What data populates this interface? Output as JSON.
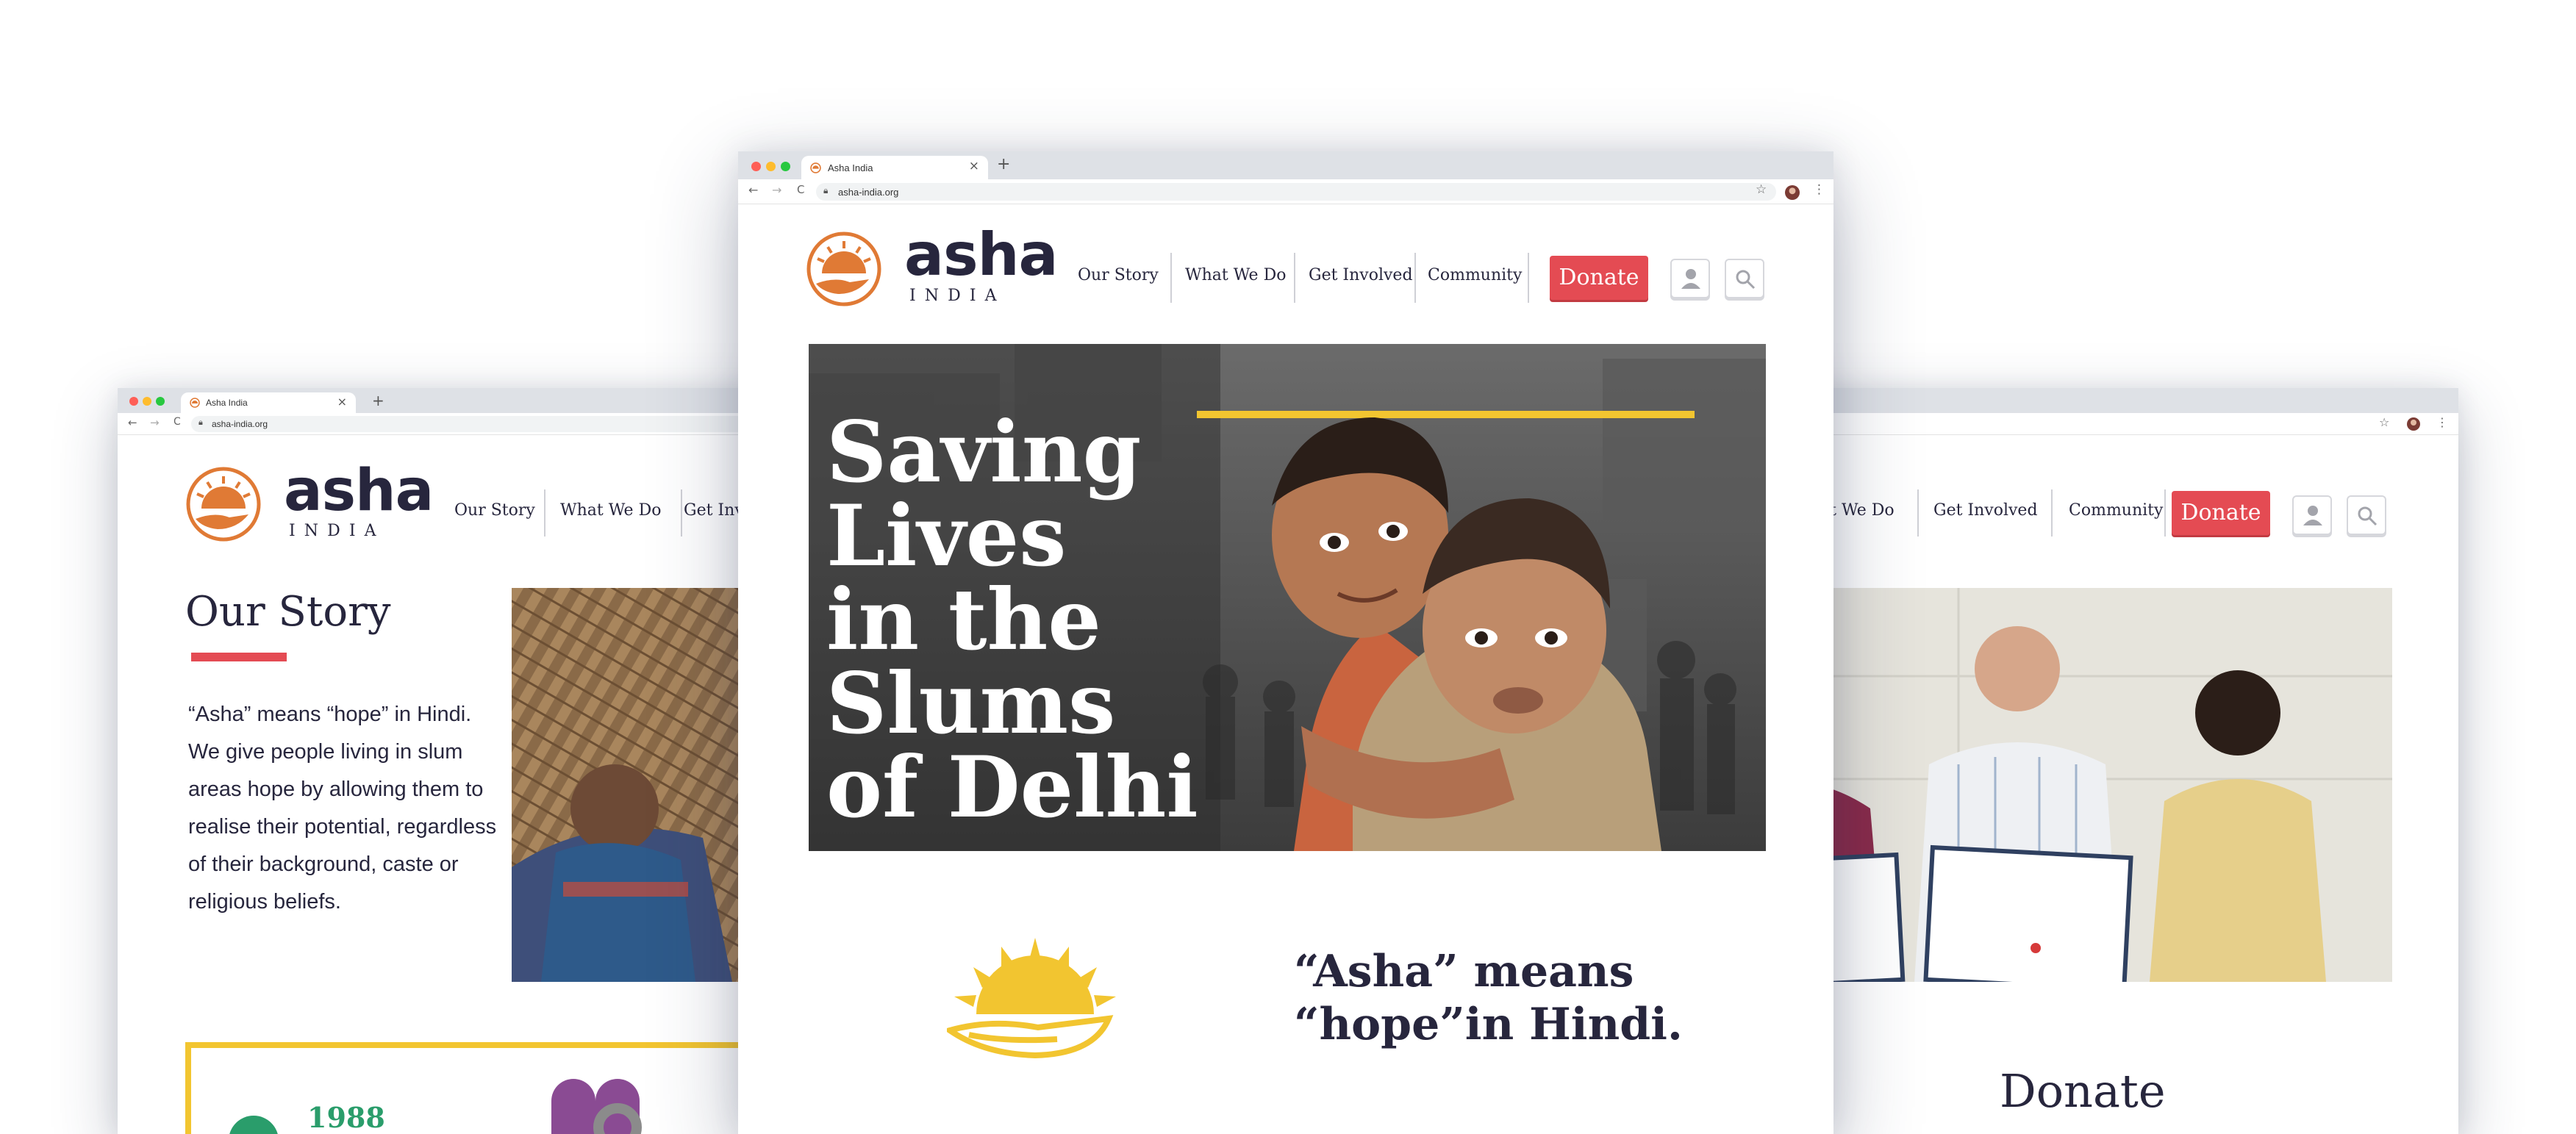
{
  "browser": {
    "tab_title": "Asha India",
    "tab_close": "×",
    "new_tab": "+",
    "url": "asha-india.org",
    "nav_back": "←",
    "nav_forward": "→",
    "nav_reload": "C",
    "bookmark": "☆",
    "menu": "⋮"
  },
  "brand": {
    "name": "asha",
    "tagline": "INDIA"
  },
  "nav": {
    "items": [
      "Our Story",
      "What We Do",
      "Get Involved",
      "Community"
    ],
    "left_partial_get_involved": "Get Invol",
    "right_partial_what_we_do": "at We Do",
    "donate": "Donate"
  },
  "hero": {
    "lines": [
      "Saving",
      "Lives",
      "in the",
      "Slums",
      "of Delhi"
    ]
  },
  "meaning": {
    "line1": "“Asha” means",
    "line2": "“hope”in Hindi."
  },
  "our_story": {
    "heading": "Our Story",
    "paragraph_lines": [
      "“Asha” means “hope” in Hindi.",
      "We give people living in slum",
      "areas hope by allowing them to",
      "realise their potential, regardless",
      "of their background, caste or",
      "religious beliefs."
    ],
    "year": "1988"
  },
  "right_page": {
    "donate_heading": "Donate"
  },
  "colors": {
    "accent_red": "#e44b53",
    "logo_orange": "#e07a35",
    "frame_yellow": "#f2c530",
    "frame_orange": "#e9764b",
    "text_dark": "#27263d",
    "green": "#2a9d6b",
    "purple": "#8a4b93"
  },
  "icons": [
    "search-icon",
    "user-icon",
    "star-icon",
    "lock-icon",
    "sun-hand-icon"
  ]
}
